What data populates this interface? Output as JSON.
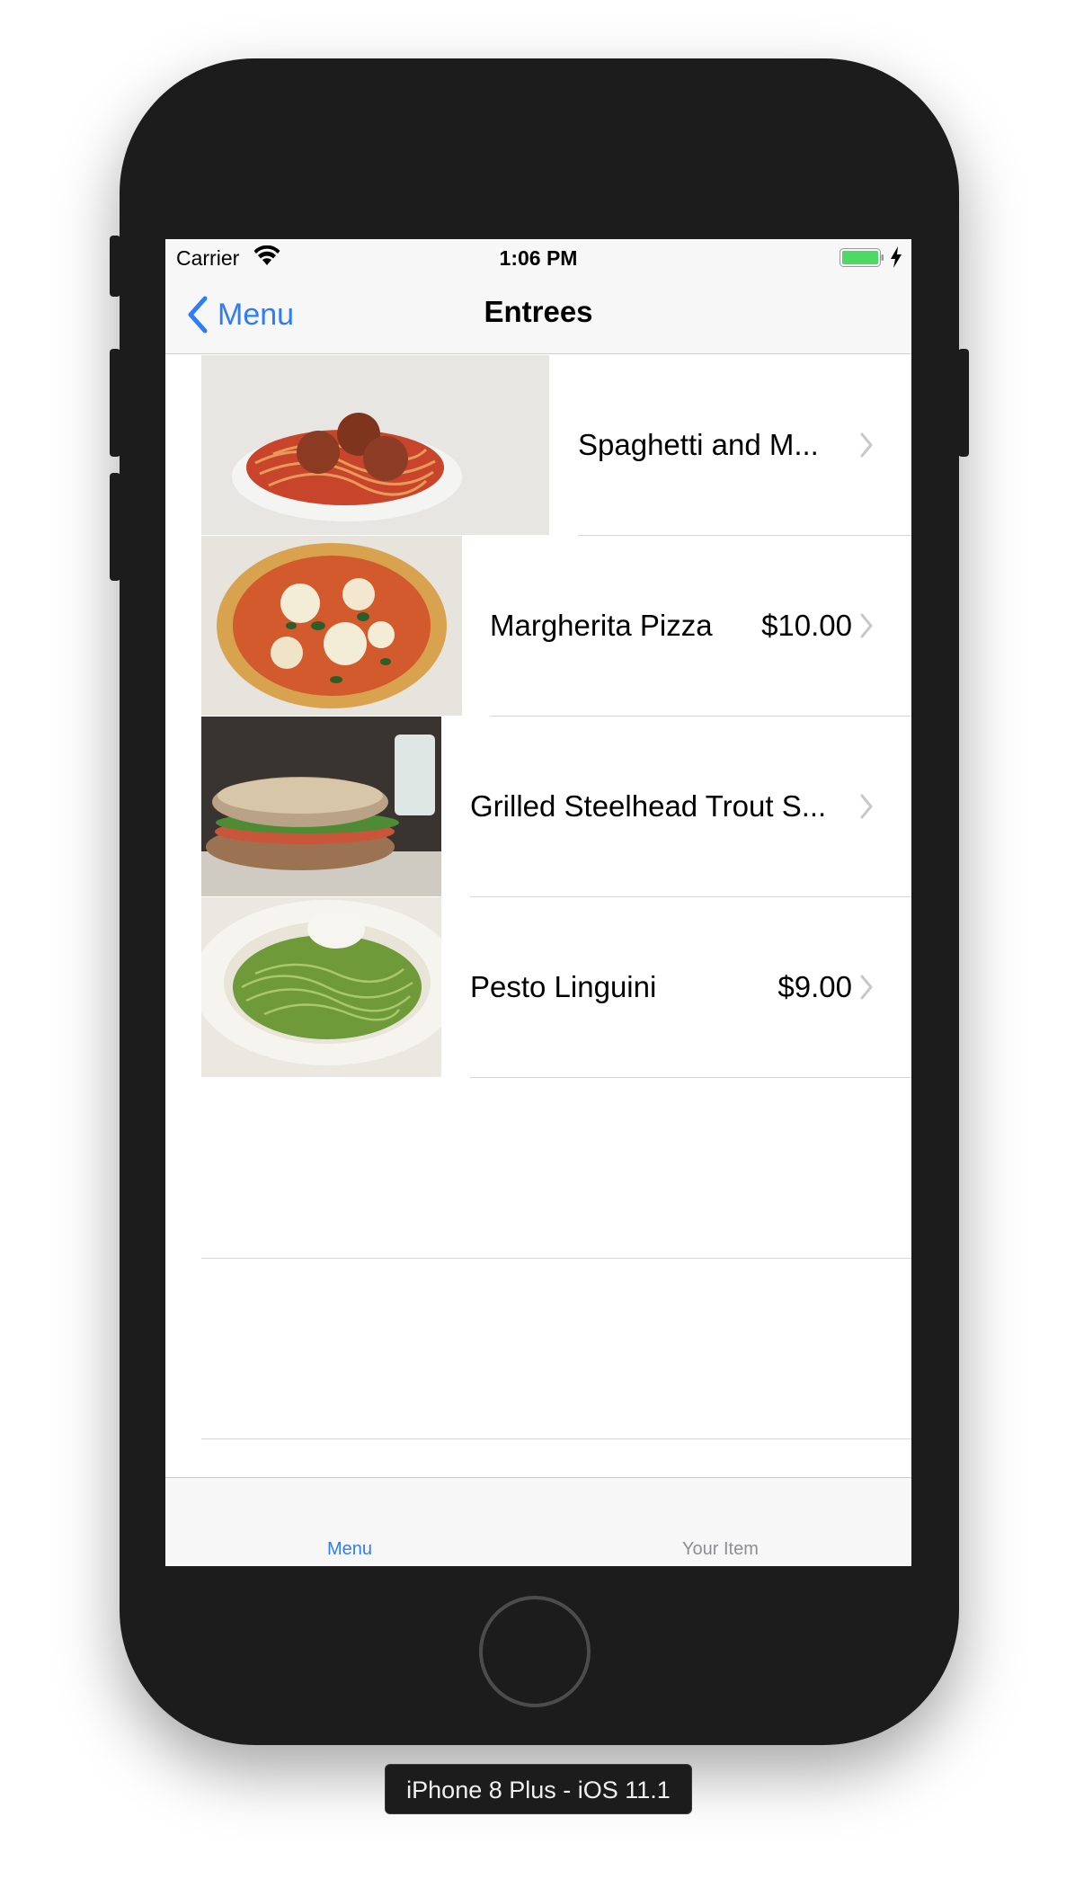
{
  "status_bar": {
    "carrier": "Carrier",
    "time": "1:06 PM"
  },
  "nav": {
    "back_label": "Menu",
    "title": "Entrees"
  },
  "items": [
    {
      "title": "Spaghetti and M...",
      "price": ""
    },
    {
      "title": "Margherita Pizza",
      "price": "$10.00"
    },
    {
      "title": "Grilled Steelhead Trout S...",
      "price": ""
    },
    {
      "title": "Pesto Linguini",
      "price": "$9.00"
    }
  ],
  "tabs": [
    {
      "label": "Menu",
      "selected": true
    },
    {
      "label": "Your Item",
      "selected": false
    }
  ],
  "device_label": "iPhone 8 Plus - iOS 11.1",
  "colors": {
    "accent": "#2f7df6",
    "battery": "#4cd964",
    "tab_inactive": "#8e8e93"
  }
}
